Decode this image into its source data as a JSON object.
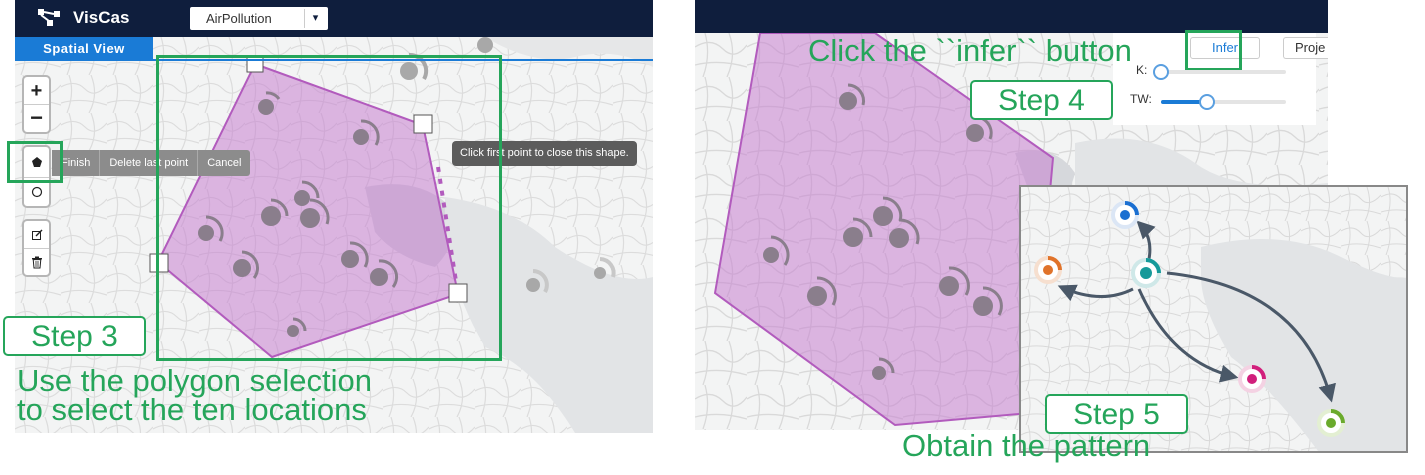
{
  "left_window": {
    "app_title": "VisCas",
    "dataset_select": {
      "value": "AirPollution"
    },
    "view_tab": "Spatial View",
    "zoom_in_label": "+",
    "zoom_out_label": "−",
    "draw_actions": [
      "Finish",
      "Delete last point",
      "Cancel"
    ],
    "draw_tooltip": "Click first point to close this shape."
  },
  "right_window": {
    "infer_label": "Infer",
    "project_label": "Proje",
    "k_label": "K:",
    "tw_label": "TW:",
    "k_slider_value": 0.0,
    "tw_slider_value": 0.37
  },
  "annotations": {
    "step3_label": "Step 3",
    "step3_caption_line1": "Use the polygon selection",
    "step3_caption_line2": "to select the ten locations",
    "step4_caption": "Click the ``infer`` button",
    "step4_label": "Step 4",
    "step5_label": "Step 5",
    "step5_caption": "Obtain the pattern"
  },
  "icons": {
    "logo": "network-nodes-icon",
    "select_chevron": "chevron-down-icon",
    "polygon_tool": "pentagon-icon",
    "circle_tool": "circle-icon",
    "edit_tool": "edit-icon",
    "delete_tool": "trash-icon"
  },
  "colors": {
    "topbar": "#0f1e3d",
    "accent_blue": "#1a7bd6",
    "annotation_green": "#25a55a",
    "selection_fill": "#c77fd0",
    "selection_stroke": "#b25bbd",
    "location_marker": "#8a7e8c",
    "pattern_arrow": "#4a5868",
    "pattern_node_colors": [
      "#1a6fd1",
      "#e0732a",
      "#169a9a",
      "#d11f7c",
      "#6aaa2c"
    ]
  }
}
